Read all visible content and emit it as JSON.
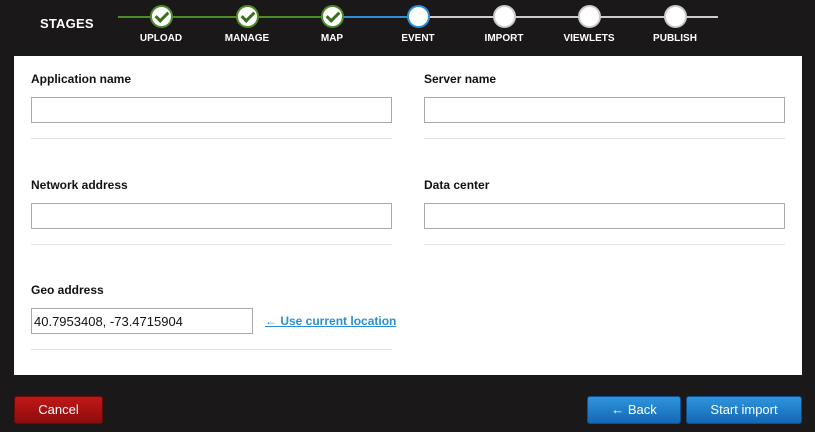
{
  "stages": {
    "title": "STAGES",
    "items": [
      {
        "label": "UPLOAD",
        "status": "done"
      },
      {
        "label": "MANAGE",
        "status": "done"
      },
      {
        "label": "MAP",
        "status": "done"
      },
      {
        "label": "EVENT",
        "status": "current"
      },
      {
        "label": "IMPORT",
        "status": "todo"
      },
      {
        "label": "VIEWLETS",
        "status": "todo"
      },
      {
        "label": "PUBLISH",
        "status": "todo"
      }
    ],
    "colors": {
      "done": "#4c8d2a",
      "current": "#2e8fd6",
      "todo": "#cccccc"
    }
  },
  "form": {
    "application_name": {
      "label": "Application name",
      "value": ""
    },
    "server_name": {
      "label": "Server name",
      "value": ""
    },
    "network_address": {
      "label": "Network address",
      "value": ""
    },
    "data_center": {
      "label": "Data center",
      "value": ""
    },
    "geo_address": {
      "label": "Geo address",
      "value": "40.7953408, -73.4715904"
    },
    "use_location_link": "← Use current location"
  },
  "footer": {
    "cancel_label": "Cancel",
    "back_label": "← Back",
    "start_label": "Start import"
  }
}
